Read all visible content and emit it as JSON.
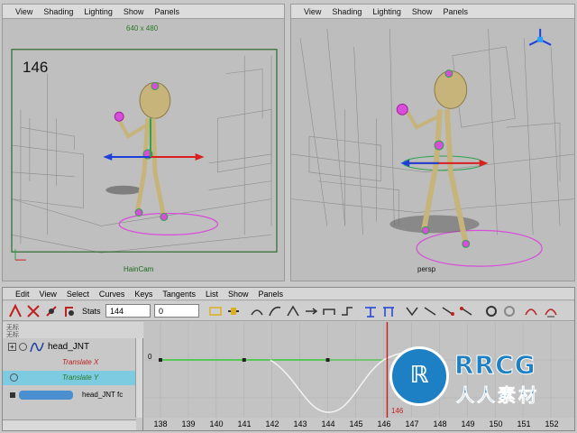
{
  "viewport_menu": [
    "View",
    "Shading",
    "Lighting",
    "Show",
    "Panels"
  ],
  "left_viewport": {
    "resolution": "640 x 480",
    "frame": "146",
    "camera": "HainCam"
  },
  "right_viewport": {
    "camera": "persp"
  },
  "graph_editor": {
    "menu": [
      "Edit",
      "View",
      "Select",
      "Curves",
      "Keys",
      "Tangents",
      "List",
      "Show",
      "Panels"
    ],
    "stats_label": "Stats",
    "stats_value_1": "144",
    "stats_value_2": "0",
    "outliner": {
      "header_1": "无标",
      "header_2": "无标",
      "node": "head_JNT",
      "channel_x": "Translate X",
      "channel_y": "Translate Y",
      "node_short": "head_JNT fc"
    },
    "curve_zero_label": "0",
    "current_frame_label": "146",
    "ruler_ticks": [
      "138",
      "139",
      "140",
      "141",
      "142",
      "143",
      "144",
      "145",
      "146",
      "147",
      "148",
      "149",
      "150",
      "151",
      "152"
    ]
  },
  "watermark": {
    "brand": "RRCG",
    "sub": "人人素材"
  },
  "colors": {
    "curve_green": "#58c858",
    "curve_white": "#f2f2f2",
    "current_time": "#c82020",
    "selection": "#7ccbe0",
    "brand_blue": "#1d7fc4"
  }
}
